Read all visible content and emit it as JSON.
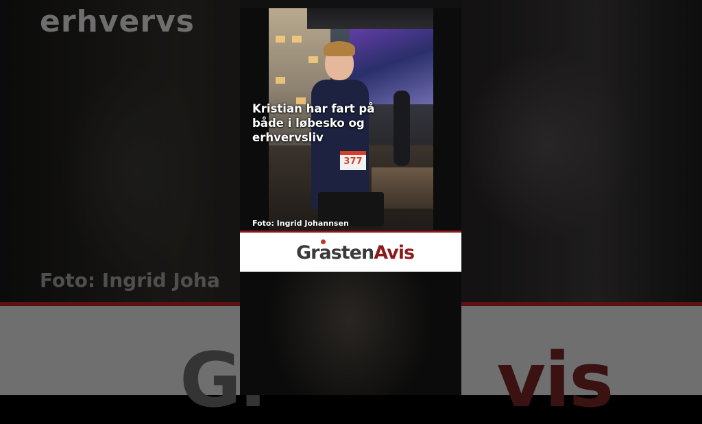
{
  "background": {
    "title_fragment": "erhvervs",
    "caption_fragment": "Foto: Ingrid Joha",
    "logo_left": "Gr",
    "logo_right": "vis"
  },
  "card": {
    "headline": "Kristian har fart på både i løbesko og erhvervsliv",
    "photo_credit": "Foto: Ingrid Johannsen",
    "bib_number": "377",
    "logo": {
      "part1": "Grasten",
      "part2": "Avis",
      "part1_color": "#3a3a3a",
      "part2_color": "#8b1a1a"
    }
  },
  "colors": {
    "brand_red": "#8b1a1a",
    "text_light": "#ffffff"
  }
}
